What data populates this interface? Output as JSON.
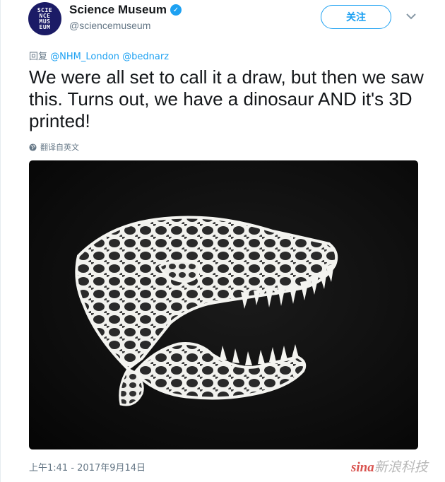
{
  "account": {
    "display_name": "Science Museum",
    "handle": "@sciencemuseum",
    "avatar_text": [
      "SCIE",
      "NCE",
      "MUS",
      "EUM"
    ]
  },
  "header": {
    "follow_label": "关注"
  },
  "reply": {
    "prefix": "回复",
    "mentions": "@NHM_London @bednarz"
  },
  "tweet": {
    "text": "We were all set to call it a draw, but then we saw this. Turns out, we have a dinosaur AND it's 3D printed!",
    "translate_label": "翻译自英文"
  },
  "media": {
    "icon": "3d-printed-dinosaur-skull-image"
  },
  "footer": {
    "timestamp": "上午1:41 - 2017年9月14日"
  },
  "watermark": {
    "text": "新浪科技",
    "brand": "sina"
  },
  "colors": {
    "accent": "#1da1f2",
    "text": "#14171a",
    "muted": "#657786",
    "avatar_bg": "#1b1b66"
  }
}
